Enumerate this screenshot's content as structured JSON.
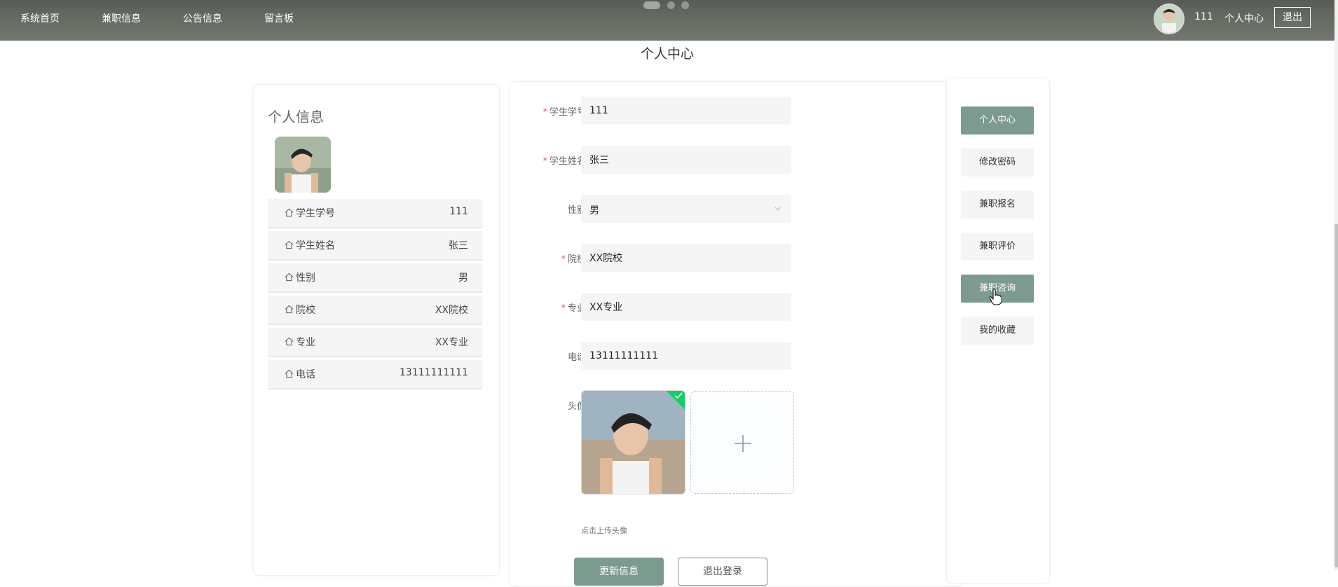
{
  "nav": {
    "items": [
      "系统首页",
      "兼职信息",
      "公告信息",
      "留言板"
    ],
    "user_id": "111",
    "profile_link": "个人中心",
    "logout": "退出"
  },
  "page_title": "个人中心",
  "profile_card": {
    "heading": "个人信息",
    "rows": [
      {
        "label": "学生学号",
        "value": "111"
      },
      {
        "label": "学生姓名",
        "value": "张三"
      },
      {
        "label": "性别",
        "value": "男"
      },
      {
        "label": "院校",
        "value": "XX院校"
      },
      {
        "label": "专业",
        "value": "XX专业"
      },
      {
        "label": "电话",
        "value": "13111111111"
      }
    ]
  },
  "form": {
    "student_no": {
      "label": "学生学号",
      "value": "111",
      "required": true
    },
    "student_name": {
      "label": "学生姓名",
      "value": "张三",
      "required": true
    },
    "gender": {
      "label": "性别",
      "value": "男",
      "required": false
    },
    "school": {
      "label": "院校",
      "value": "XX院校",
      "required": true
    },
    "major": {
      "label": "专业",
      "value": "XX专业",
      "required": true
    },
    "phone": {
      "label": "电话",
      "value": "13111111111",
      "required": false
    },
    "avatar": {
      "label": "头像",
      "hint": "点击上传头像"
    },
    "update_button": "更新信息",
    "quit_button": "退出登录"
  },
  "side_menu": {
    "items": [
      "个人中心",
      "修改密码",
      "兼职报名",
      "兼职评价",
      "兼职咨询",
      "我的收藏"
    ],
    "active_index": 0,
    "hover_index": 4
  },
  "colors": {
    "accent": "#7c9b8f",
    "required": "#e05858",
    "upload_success": "#13ce66"
  },
  "icons": [
    "home-icon",
    "chevron-down-icon",
    "plus-icon",
    "check-icon",
    "pointer-cursor-icon"
  ]
}
